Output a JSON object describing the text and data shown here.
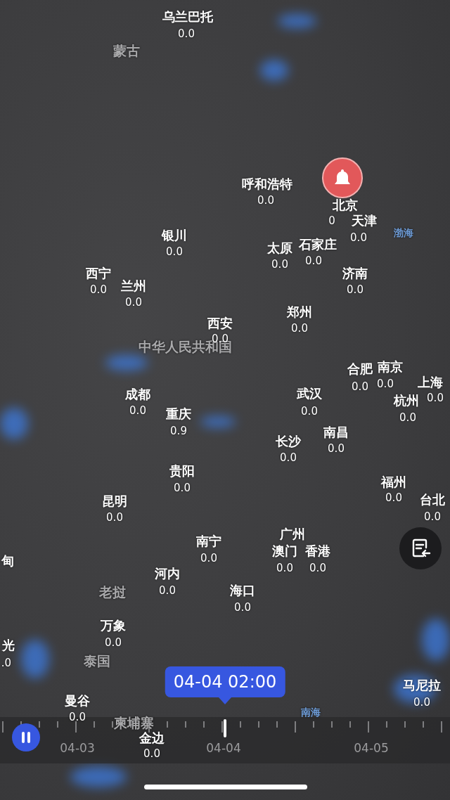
{
  "map": {
    "country_labels": [
      "蒙古",
      "中华人民共和国",
      "老挝",
      "泰国",
      "柬埔寨"
    ],
    "sea_labels": [
      "渤海",
      "南海"
    ],
    "cities": [
      {
        "name": "乌兰巴托",
        "value": "0.0"
      },
      {
        "name": "呼和浩特",
        "value": "0.0"
      },
      {
        "name": "北京",
        "value": "0"
      },
      {
        "name": "天津",
        "value": "0.0"
      },
      {
        "name": "银川",
        "value": "0.0"
      },
      {
        "name": "太原",
        "value": "0.0"
      },
      {
        "name": "石家庄",
        "value": "0.0"
      },
      {
        "name": "西宁",
        "value": "0.0"
      },
      {
        "name": "兰州",
        "value": "0.0"
      },
      {
        "name": "济南",
        "value": "0.0"
      },
      {
        "name": "郑州",
        "value": "0.0"
      },
      {
        "name": "西安",
        "value": "0.0"
      },
      {
        "name": "合肥",
        "value": "0.0"
      },
      {
        "name": "南京",
        "value": "0.0"
      },
      {
        "name": "上海",
        "value": "0.0"
      },
      {
        "name": "杭州",
        "value": "0.0"
      },
      {
        "name": "成都",
        "value": "0.0"
      },
      {
        "name": "武汉",
        "value": "0.0"
      },
      {
        "name": "重庆",
        "value": "0.9"
      },
      {
        "name": "长沙",
        "value": "0.0"
      },
      {
        "name": "南昌",
        "value": "0.0"
      },
      {
        "name": "贵阳",
        "value": "0.0"
      },
      {
        "name": "福州",
        "value": "0.0"
      },
      {
        "name": "昆明",
        "value": "0.0"
      },
      {
        "name": "台北",
        "value": "0.0"
      },
      {
        "name": "南宁",
        "value": "0.0"
      },
      {
        "name": "广州"
      },
      {
        "name": "澳门",
        "value": "0.0"
      },
      {
        "name": "香港",
        "value": "0.0"
      },
      {
        "name": "河内",
        "value": "0.0"
      },
      {
        "name": "海口",
        "value": "0.0"
      },
      {
        "name": "万象",
        "value": "0.0"
      },
      {
        "name": "甸"
      },
      {
        "name": "光",
        "value": ".0"
      },
      {
        "name": "曼谷",
        "value": "0.0"
      },
      {
        "name": "马尼拉",
        "value": "0.0"
      },
      {
        "name": "金边",
        "value": "0.0"
      }
    ]
  },
  "time_bubble": {
    "label": "04-04 02:00"
  },
  "timeline": {
    "playing": true,
    "date_labels": [
      "04-03",
      "04-04",
      "04-05"
    ]
  }
}
